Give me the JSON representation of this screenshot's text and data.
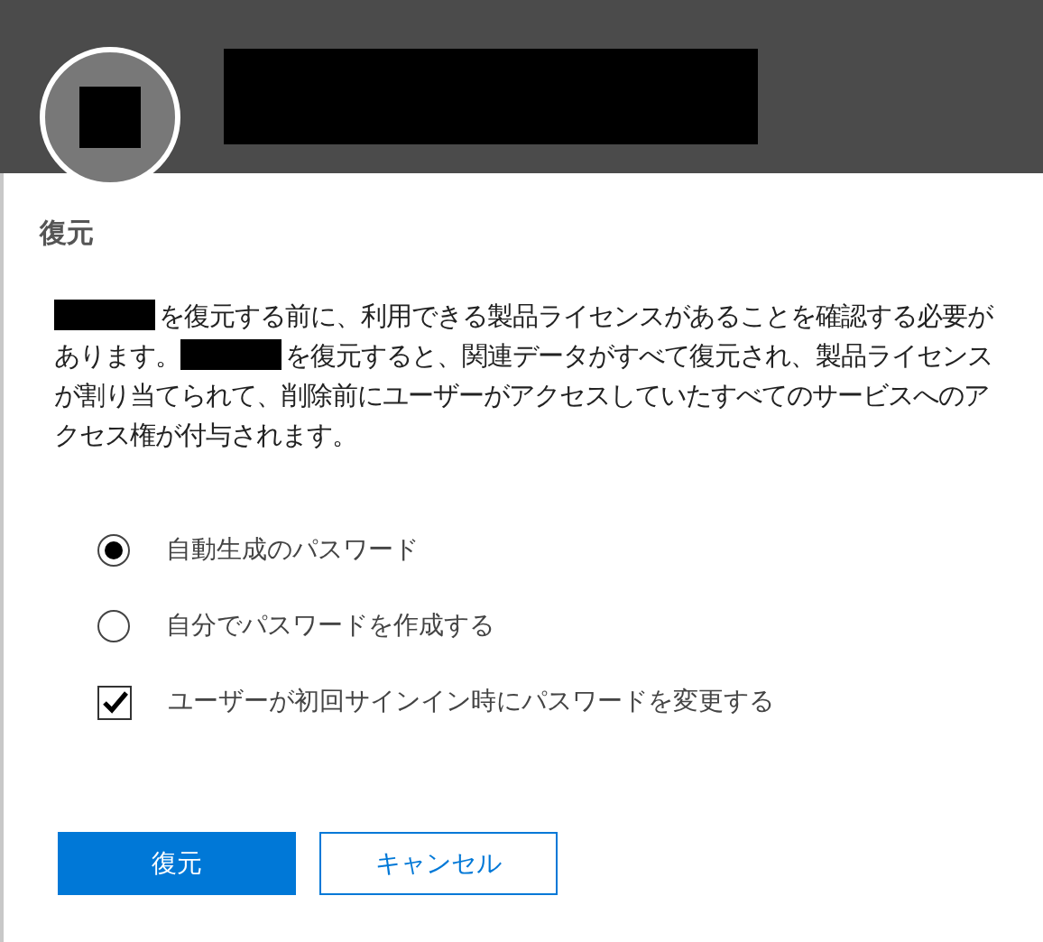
{
  "header": {
    "avatar_redacted": true,
    "name_redacted": true
  },
  "title": "復元",
  "message": [
    {
      "kind": "redacted"
    },
    {
      "kind": "text",
      "text": "を復元する前に、利用できる製品ライセンスがあることを確認する必要があります。"
    },
    {
      "kind": "redacted"
    },
    {
      "kind": "text",
      "text": "を復元すると、関連データがすべて復元され、製品ライセンスが割り当てられて、削除前にユーザーがアクセスしていたすべてのサービスへのアクセス権が付与されます。"
    }
  ],
  "options": [
    {
      "kind": "radio",
      "label": "自動生成のパスワード",
      "selected": true
    },
    {
      "kind": "radio",
      "label": "自分でパスワードを作成する",
      "selected": false
    },
    {
      "kind": "checkbox",
      "label": "ユーザーが初回サインイン時にパスワードを変更する",
      "checked": true
    }
  ],
  "buttons": [
    {
      "kind": "primary",
      "label": "復元"
    },
    {
      "kind": "secondary",
      "label": "キャンセル"
    }
  ]
}
